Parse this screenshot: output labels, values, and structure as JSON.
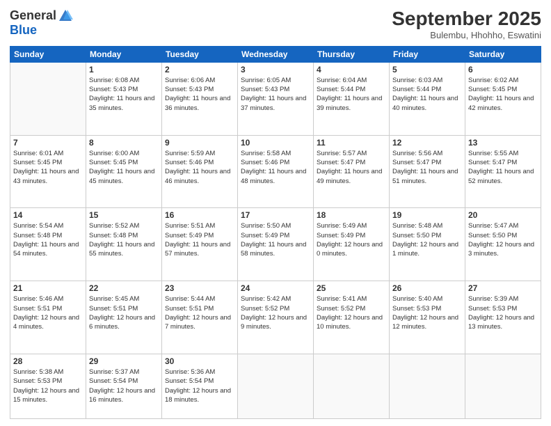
{
  "logo": {
    "general": "General",
    "blue": "Blue"
  },
  "header": {
    "month": "September 2025",
    "location": "Bulembu, Hhohho, Eswatini"
  },
  "days": [
    "Sunday",
    "Monday",
    "Tuesday",
    "Wednesday",
    "Thursday",
    "Friday",
    "Saturday"
  ],
  "weeks": [
    [
      {
        "num": "",
        "empty": true
      },
      {
        "num": "1",
        "sunrise": "6:08 AM",
        "sunset": "5:43 PM",
        "daylight": "11 hours and 35 minutes."
      },
      {
        "num": "2",
        "sunrise": "6:06 AM",
        "sunset": "5:43 PM",
        "daylight": "11 hours and 36 minutes."
      },
      {
        "num": "3",
        "sunrise": "6:05 AM",
        "sunset": "5:43 PM",
        "daylight": "11 hours and 37 minutes."
      },
      {
        "num": "4",
        "sunrise": "6:04 AM",
        "sunset": "5:44 PM",
        "daylight": "11 hours and 39 minutes."
      },
      {
        "num": "5",
        "sunrise": "6:03 AM",
        "sunset": "5:44 PM",
        "daylight": "11 hours and 40 minutes."
      },
      {
        "num": "6",
        "sunrise": "6:02 AM",
        "sunset": "5:45 PM",
        "daylight": "11 hours and 42 minutes."
      }
    ],
    [
      {
        "num": "7",
        "sunrise": "6:01 AM",
        "sunset": "5:45 PM",
        "daylight": "11 hours and 43 minutes."
      },
      {
        "num": "8",
        "sunrise": "6:00 AM",
        "sunset": "5:45 PM",
        "daylight": "11 hours and 45 minutes."
      },
      {
        "num": "9",
        "sunrise": "5:59 AM",
        "sunset": "5:46 PM",
        "daylight": "11 hours and 46 minutes."
      },
      {
        "num": "10",
        "sunrise": "5:58 AM",
        "sunset": "5:46 PM",
        "daylight": "11 hours and 48 minutes."
      },
      {
        "num": "11",
        "sunrise": "5:57 AM",
        "sunset": "5:47 PM",
        "daylight": "11 hours and 49 minutes."
      },
      {
        "num": "12",
        "sunrise": "5:56 AM",
        "sunset": "5:47 PM",
        "daylight": "11 hours and 51 minutes."
      },
      {
        "num": "13",
        "sunrise": "5:55 AM",
        "sunset": "5:47 PM",
        "daylight": "11 hours and 52 minutes."
      }
    ],
    [
      {
        "num": "14",
        "sunrise": "5:54 AM",
        "sunset": "5:48 PM",
        "daylight": "11 hours and 54 minutes."
      },
      {
        "num": "15",
        "sunrise": "5:52 AM",
        "sunset": "5:48 PM",
        "daylight": "11 hours and 55 minutes."
      },
      {
        "num": "16",
        "sunrise": "5:51 AM",
        "sunset": "5:49 PM",
        "daylight": "11 hours and 57 minutes."
      },
      {
        "num": "17",
        "sunrise": "5:50 AM",
        "sunset": "5:49 PM",
        "daylight": "11 hours and 58 minutes."
      },
      {
        "num": "18",
        "sunrise": "5:49 AM",
        "sunset": "5:49 PM",
        "daylight": "12 hours and 0 minutes."
      },
      {
        "num": "19",
        "sunrise": "5:48 AM",
        "sunset": "5:50 PM",
        "daylight": "12 hours and 1 minute."
      },
      {
        "num": "20",
        "sunrise": "5:47 AM",
        "sunset": "5:50 PM",
        "daylight": "12 hours and 3 minutes."
      }
    ],
    [
      {
        "num": "21",
        "sunrise": "5:46 AM",
        "sunset": "5:51 PM",
        "daylight": "12 hours and 4 minutes."
      },
      {
        "num": "22",
        "sunrise": "5:45 AM",
        "sunset": "5:51 PM",
        "daylight": "12 hours and 6 minutes."
      },
      {
        "num": "23",
        "sunrise": "5:44 AM",
        "sunset": "5:51 PM",
        "daylight": "12 hours and 7 minutes."
      },
      {
        "num": "24",
        "sunrise": "5:42 AM",
        "sunset": "5:52 PM",
        "daylight": "12 hours and 9 minutes."
      },
      {
        "num": "25",
        "sunrise": "5:41 AM",
        "sunset": "5:52 PM",
        "daylight": "12 hours and 10 minutes."
      },
      {
        "num": "26",
        "sunrise": "5:40 AM",
        "sunset": "5:53 PM",
        "daylight": "12 hours and 12 minutes."
      },
      {
        "num": "27",
        "sunrise": "5:39 AM",
        "sunset": "5:53 PM",
        "daylight": "12 hours and 13 minutes."
      }
    ],
    [
      {
        "num": "28",
        "sunrise": "5:38 AM",
        "sunset": "5:53 PM",
        "daylight": "12 hours and 15 minutes."
      },
      {
        "num": "29",
        "sunrise": "5:37 AM",
        "sunset": "5:54 PM",
        "daylight": "12 hours and 16 minutes."
      },
      {
        "num": "30",
        "sunrise": "5:36 AM",
        "sunset": "5:54 PM",
        "daylight": "12 hours and 18 minutes."
      },
      {
        "num": "",
        "empty": true
      },
      {
        "num": "",
        "empty": true
      },
      {
        "num": "",
        "empty": true
      },
      {
        "num": "",
        "empty": true
      }
    ]
  ]
}
